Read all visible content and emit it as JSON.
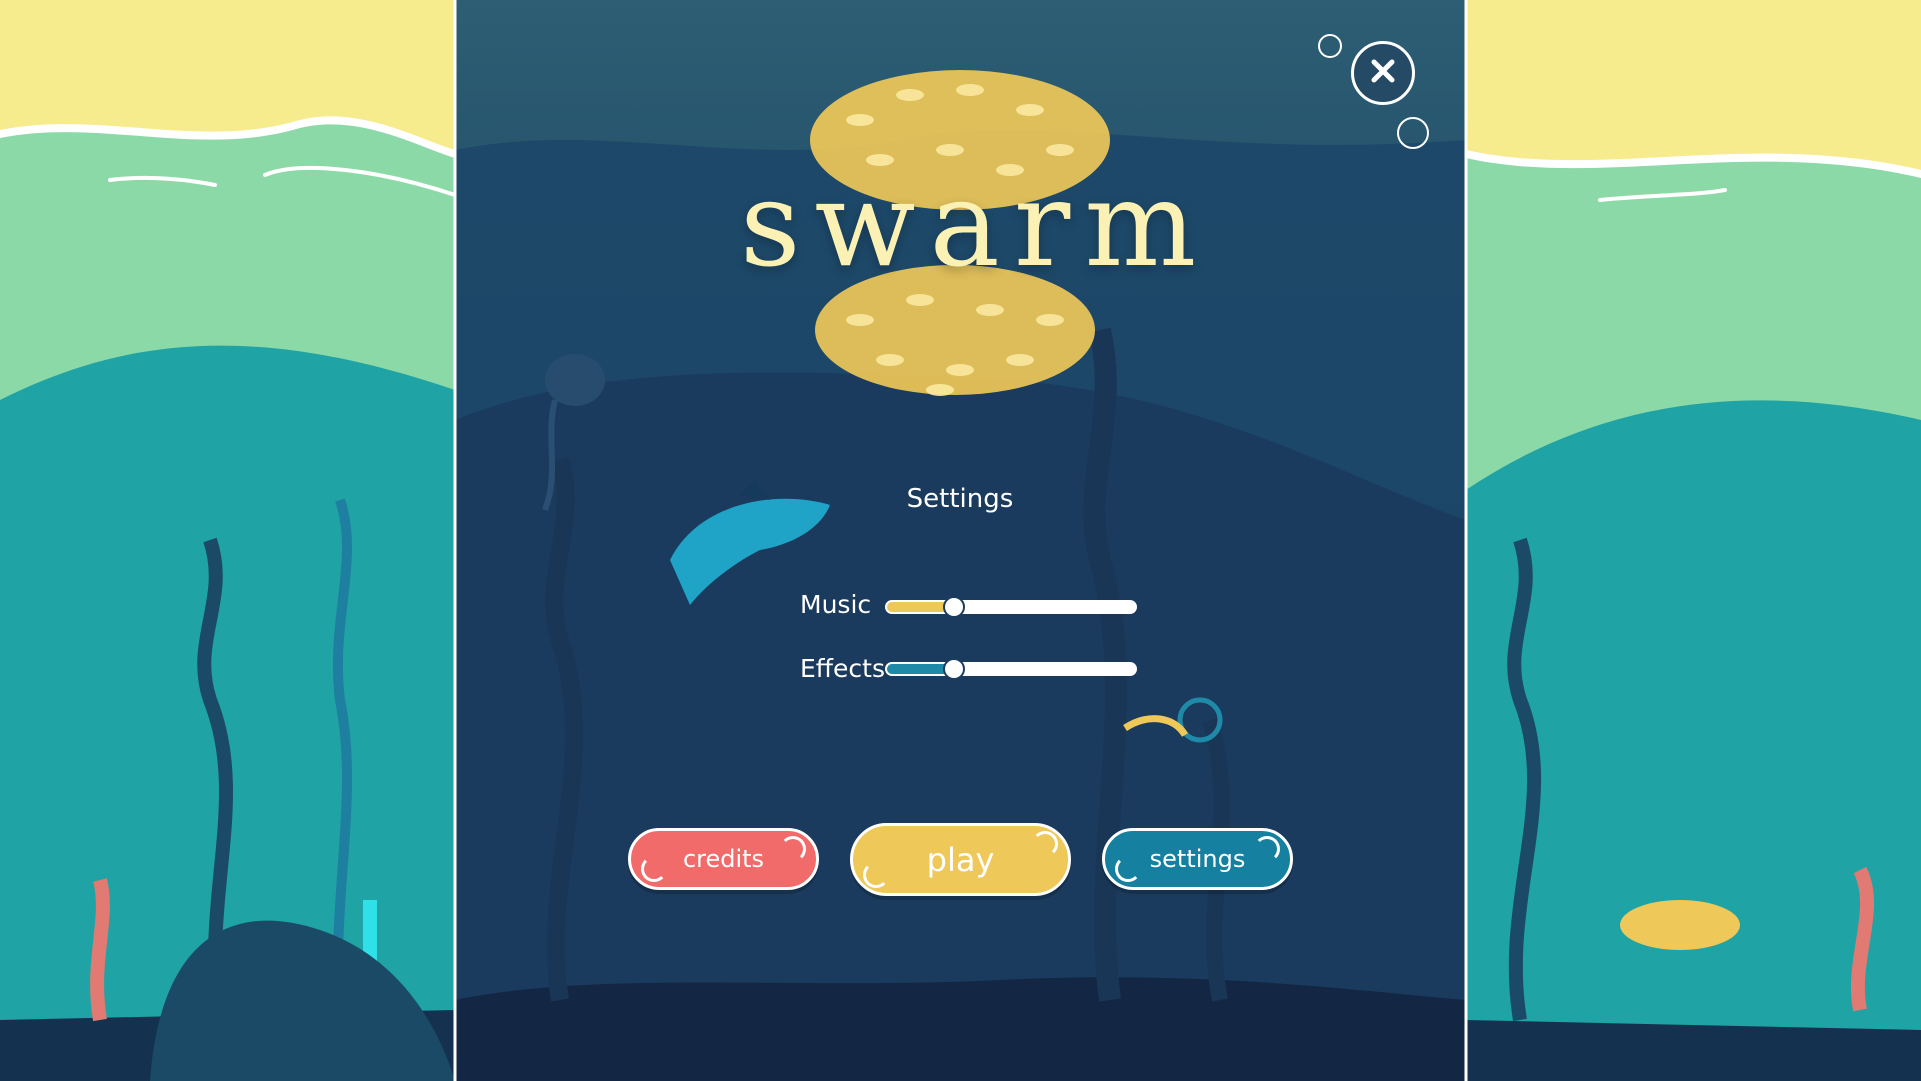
{
  "game": {
    "title": "swarm"
  },
  "settings": {
    "heading": "Settings",
    "music": {
      "label": "Music",
      "value": 0.27
    },
    "effects": {
      "label": "Effects",
      "value": 0.27
    }
  },
  "buttons": {
    "credits": "credits",
    "play": "play",
    "settings": "settings"
  },
  "icons": {
    "close": "close-icon"
  },
  "colors": {
    "sky": "#f6ec8e",
    "light_sea": "#8cd9a8",
    "mid_sea": "#1fa3a4",
    "deep_panel": "#1a3f5e",
    "credits_button": "#f26b6b",
    "play_button": "#eec858",
    "settings_button": "#15809f",
    "music_fill": "#eec858",
    "effects_fill": "#1f8aa8",
    "title_text": "#fbf1b4"
  }
}
